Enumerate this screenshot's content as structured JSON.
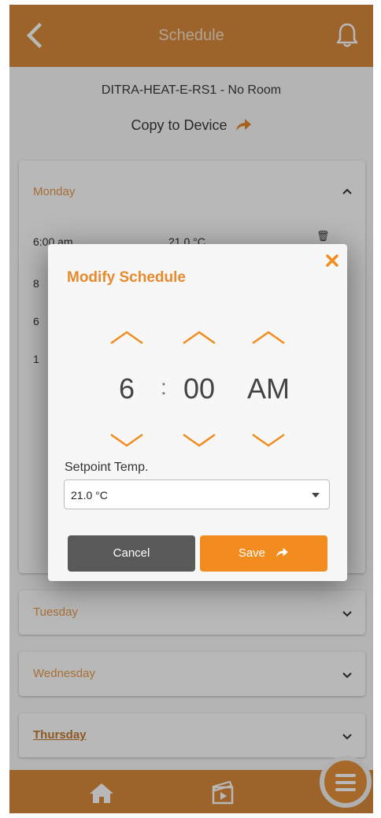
{
  "header": {
    "title": "Schedule",
    "back_icon": "chevron-left-icon",
    "notif_icon": "bell-icon"
  },
  "device": {
    "name": "DITRA-HEAT-E-RS1 - No Room",
    "copy_label": "Copy to Device",
    "copy_icon": "share-arrow-icon"
  },
  "days": [
    {
      "label": "Monday",
      "expanded": true
    },
    {
      "label": "Tuesday",
      "expanded": false
    },
    {
      "label": "Wednesday",
      "expanded": false
    },
    {
      "label": "Thursday",
      "expanded": false
    }
  ],
  "monday_rows": [
    {
      "time": "6:00 am",
      "temp": "21.0 °C",
      "partial": [
        "8",
        "6",
        "1"
      ]
    }
  ],
  "modal": {
    "title": "Modify Schedule",
    "hour": "6",
    "separator": ":",
    "minute": "00",
    "ampm": "AM",
    "setpoint_label": "Setpoint Temp.",
    "setpoint_value": "21.0 °C",
    "cancel_label": "Cancel",
    "save_label": "Save"
  },
  "bottom_nav": {
    "home_icon": "home-icon",
    "video_icon": "video-icon",
    "menu_icon": "menu-icon"
  },
  "colors": {
    "brand": "#d9893b",
    "accent": "#f28c1f",
    "cancel": "#595959"
  }
}
